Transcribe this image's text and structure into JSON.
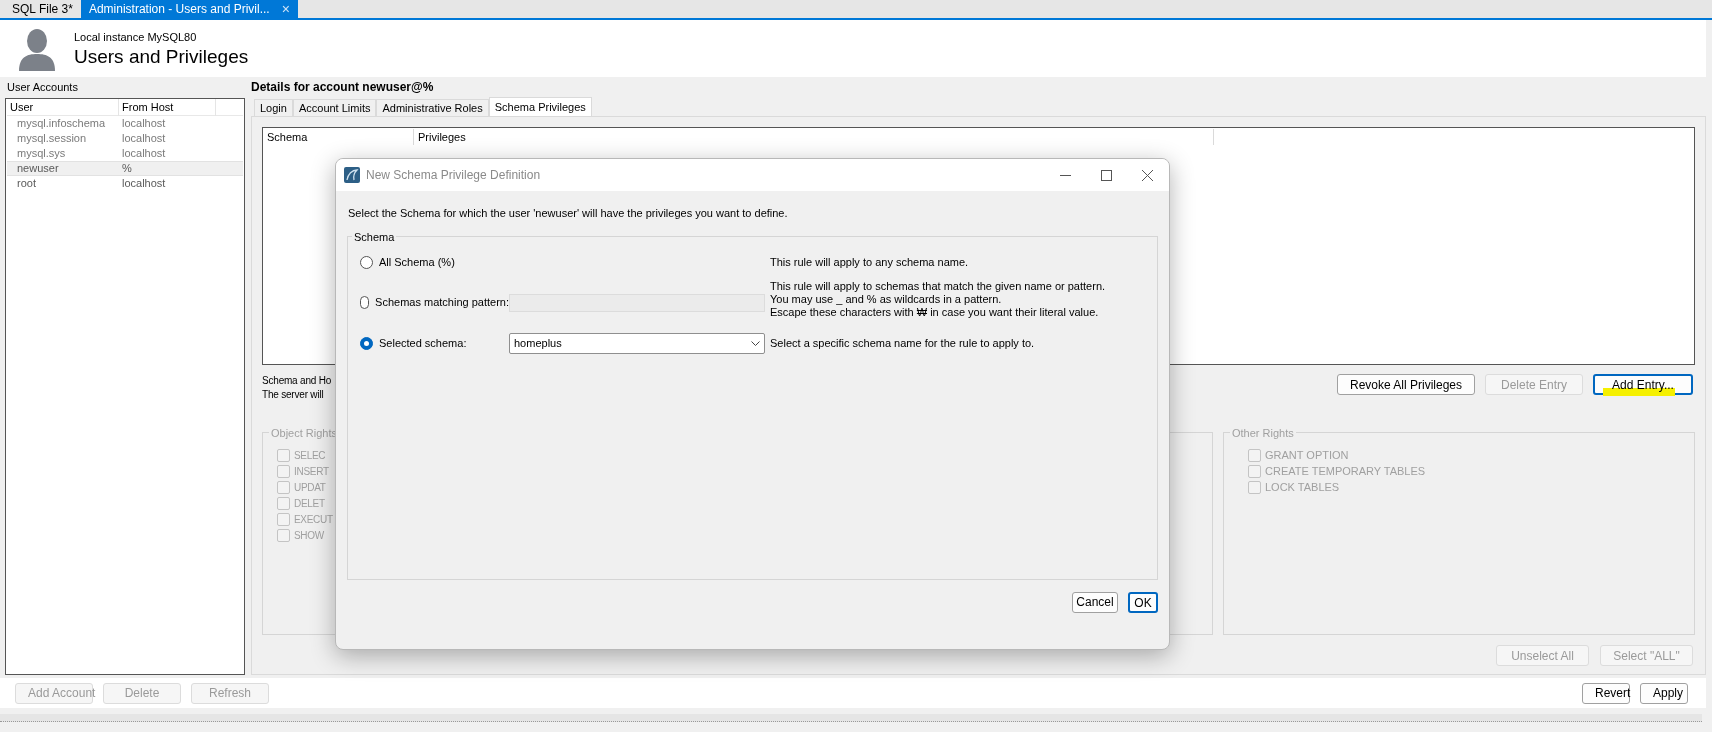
{
  "doc_tabs": [
    {
      "label": "SQL File 3*",
      "selected": false,
      "closable": false
    },
    {
      "label": "Administration - Users and Privil...",
      "selected": true,
      "closable": true
    }
  ],
  "close_glyph": "×",
  "header": {
    "subtitle": "Local instance MySQL80",
    "title": "Users and Privileges"
  },
  "accounts": {
    "label": "User Accounts",
    "columns": [
      "User",
      "From Host"
    ],
    "rows": [
      {
        "user": "mysql.infoschema",
        "host": "localhost",
        "disabled": true,
        "selected": false
      },
      {
        "user": "mysql.session",
        "host": "localhost",
        "disabled": true,
        "selected": false
      },
      {
        "user": "mysql.sys",
        "host": "localhost",
        "disabled": true,
        "selected": false
      },
      {
        "user": "newuser",
        "host": "%",
        "disabled": false,
        "selected": true
      },
      {
        "user": "root",
        "host": "localhost",
        "disabled": false,
        "selected": false
      }
    ],
    "buttons": [
      {
        "label": "Add Account",
        "disabled": true
      },
      {
        "label": "Delete",
        "disabled": true
      },
      {
        "label": "Refresh",
        "disabled": true
      }
    ]
  },
  "details": {
    "title": "Details for account newuser@%",
    "tabs": [
      {
        "label": "Login",
        "selected": false
      },
      {
        "label": "Account Limits",
        "selected": false
      },
      {
        "label": "Administrative Roles",
        "selected": false
      },
      {
        "label": "Schema Privileges",
        "selected": true
      }
    ],
    "table_columns": [
      "Schema",
      "Privileges"
    ],
    "note_lines": [
      "Schema and Ho",
      "The server will"
    ],
    "action_buttons": [
      {
        "label": "Revoke All Privileges",
        "disabled": false,
        "highlighted": false
      },
      {
        "label": "Delete Entry",
        "disabled": true,
        "highlighted": false
      },
      {
        "label": "Add Entry...",
        "disabled": false,
        "highlighted": true
      }
    ],
    "object_rights": {
      "title": "Object Rights",
      "items": [
        {
          "label": "SELEC",
          "checked": false
        },
        {
          "label": "INSERT",
          "checked": false
        },
        {
          "label": "UPDAT",
          "checked": false
        },
        {
          "label": "DELET",
          "checked": false
        },
        {
          "label": "EXECUT",
          "checked": false
        },
        {
          "label": "SHOW",
          "checked": false
        }
      ]
    },
    "other_rights": {
      "title": "Other Rights",
      "items": [
        {
          "label": "GRANT OPTION",
          "checked": false
        },
        {
          "label": "CREATE TEMPORARY TABLES",
          "checked": false
        },
        {
          "label": "LOCK TABLES",
          "checked": false
        }
      ]
    },
    "select_buttons": [
      {
        "label": "Unselect All",
        "disabled": true
      },
      {
        "label": "Select \"ALL\"",
        "disabled": true
      }
    ]
  },
  "footer_buttons": [
    {
      "label": "Revert",
      "disabled": false
    },
    {
      "label": "Apply",
      "disabled": false
    }
  ],
  "dialog": {
    "title": "New Schema Privilege Definition",
    "intro": "Select the Schema for which the user 'newuser' will have the privileges you want to define.",
    "group_title": "Schema",
    "options": [
      {
        "kind": "plain",
        "label": "All Schema (%)",
        "selected": false,
        "help": [
          "This rule will apply to any schema name."
        ]
      },
      {
        "kind": "pattern",
        "label": "Schemas matching pattern:",
        "selected": false,
        "help": [
          "This rule will apply to schemas that match the given name or pattern.",
          "You may use _ and % as wildcards in a pattern.",
          "Escape these characters with ₩ in case you want their literal value."
        ]
      },
      {
        "kind": "dropdown",
        "label": "Selected schema:",
        "selected": true,
        "value": "homeplus",
        "help": [
          "Select a specific schema name for the rule to apply to."
        ]
      }
    ],
    "buttons": [
      {
        "label": "Cancel",
        "default": false
      },
      {
        "label": "OK",
        "default": true
      }
    ]
  }
}
